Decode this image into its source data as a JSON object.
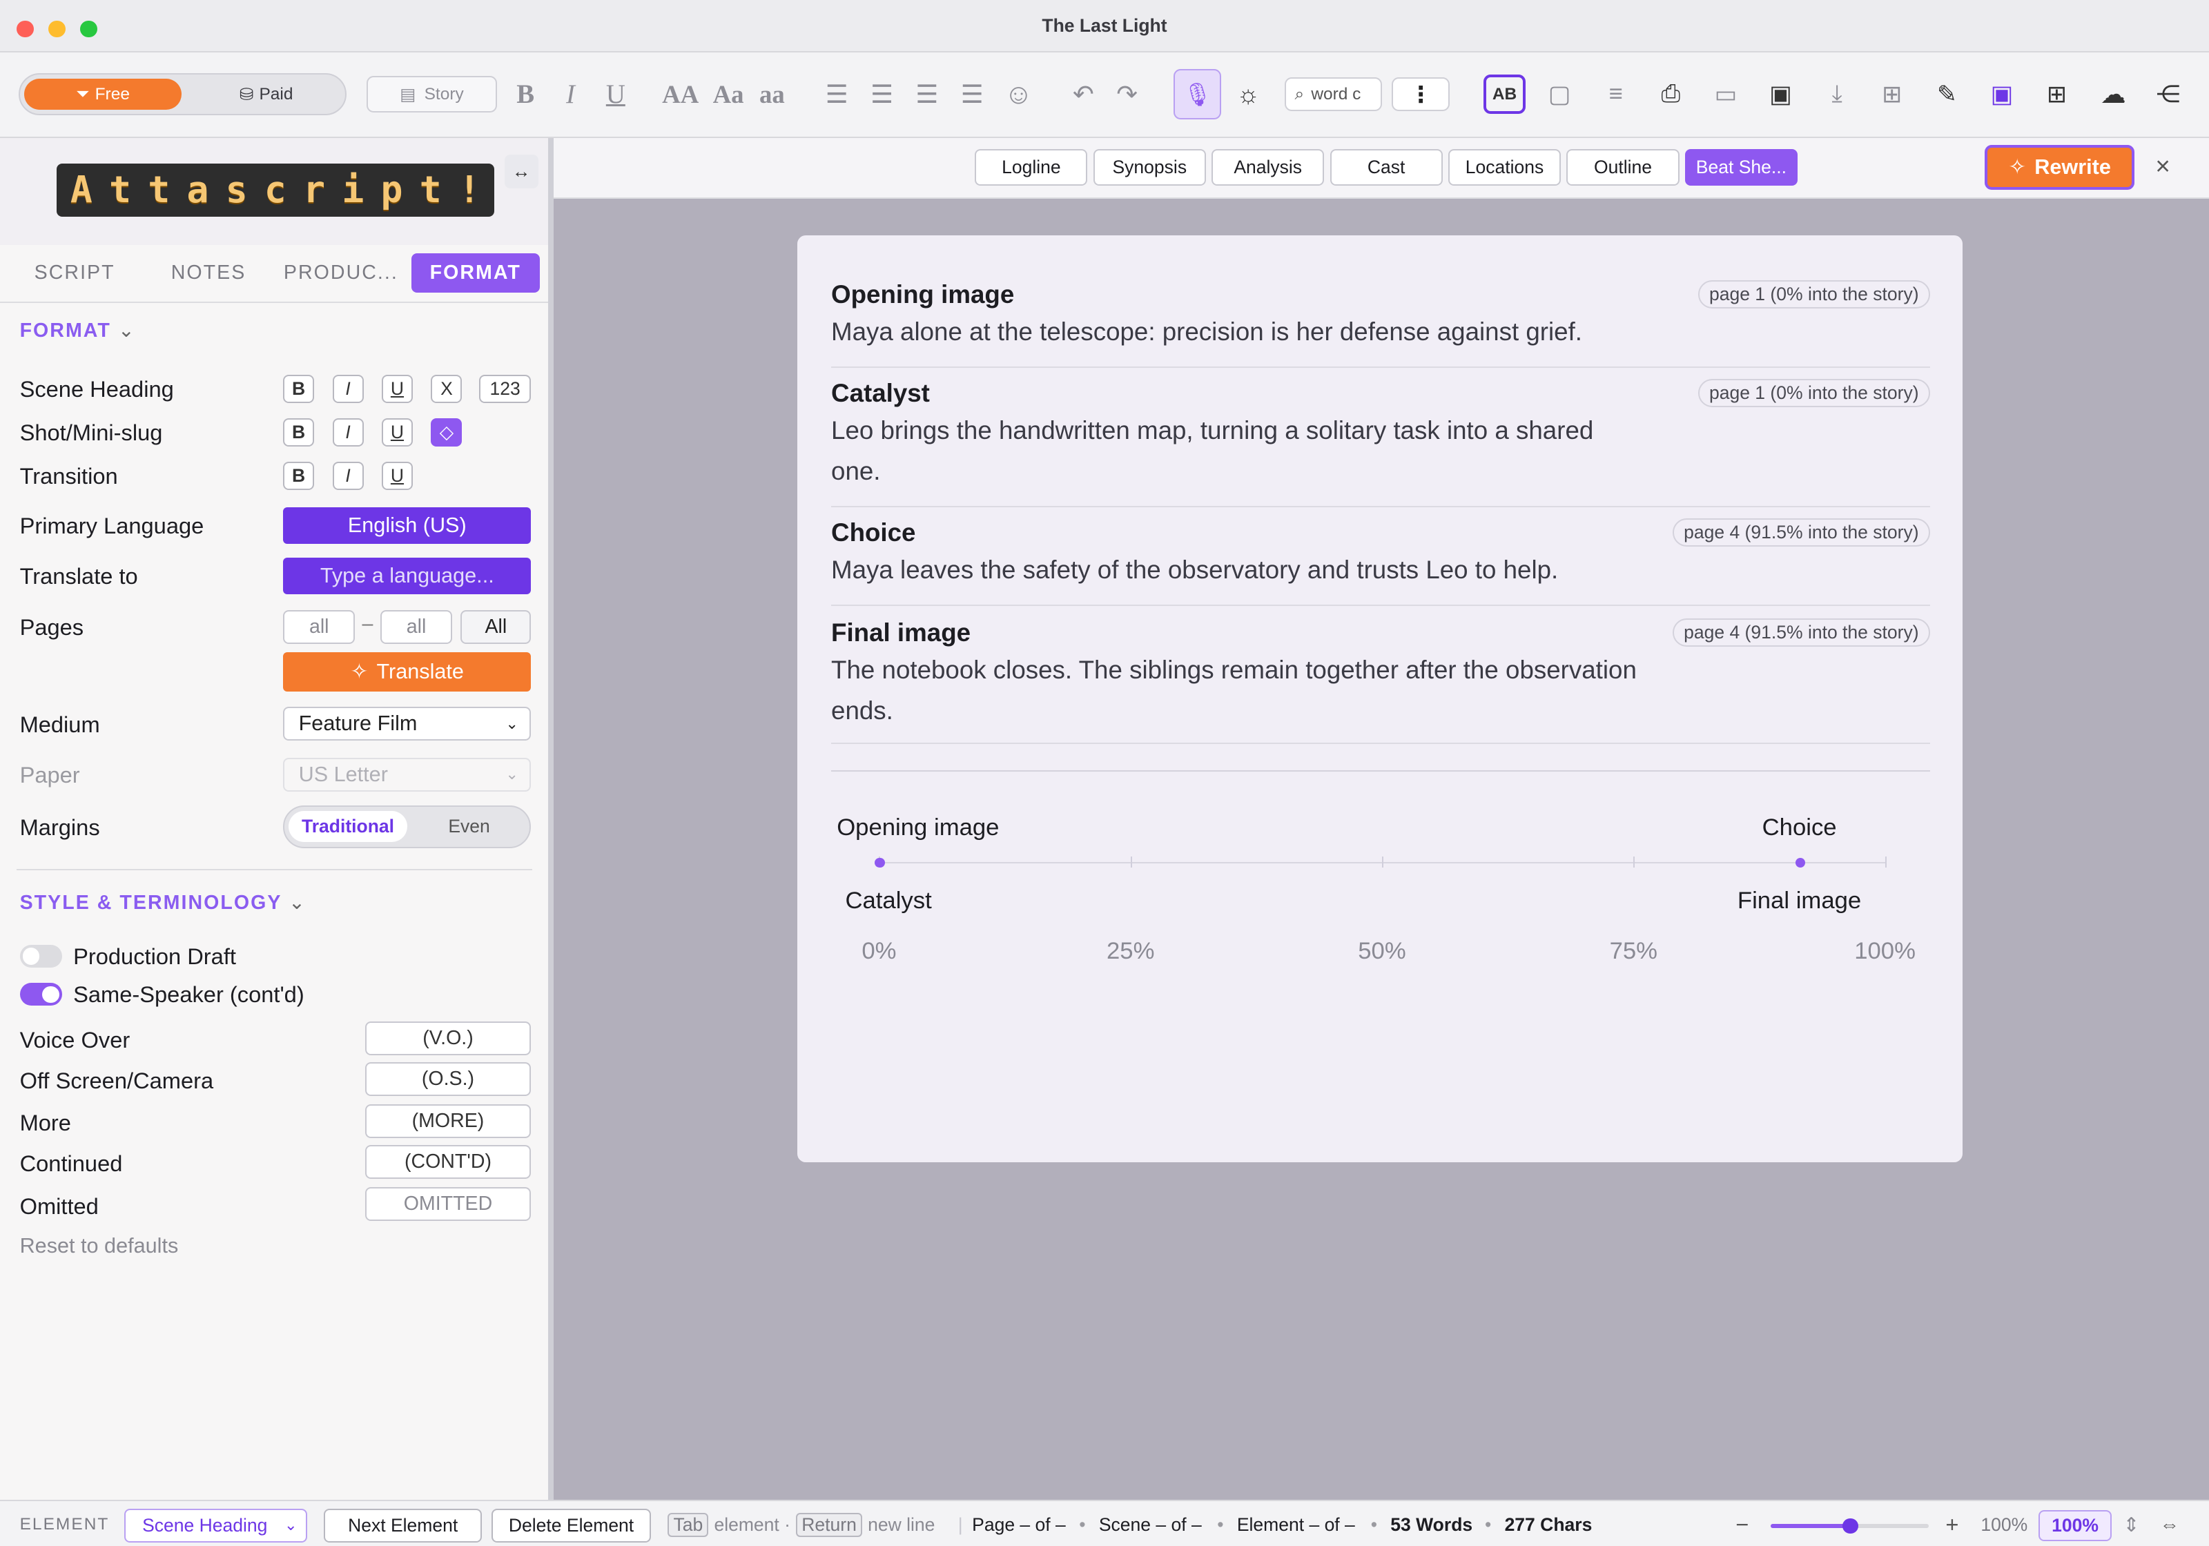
{
  "window": {
    "title": "The Last Light"
  },
  "toolbar": {
    "free_label": "Free",
    "paid_label": "Paid",
    "story_label": "Story",
    "search_placeholder": "word c",
    "accent": "#8e58f0",
    "orange": "#f47a2d"
  },
  "sidebar": {
    "tabs": [
      "SCRIPT",
      "NOTES",
      "PRODUC...",
      "FORMAT"
    ],
    "format_heading": "FORMAT",
    "rows": {
      "scene_heading": "Scene Heading",
      "shot": "Shot/Mini-slug",
      "transition": "Transition",
      "primary_language": "Primary Language",
      "translate_to": "Translate to",
      "pages": "Pages",
      "medium": "Medium",
      "paper": "Paper",
      "margins": "Margins"
    },
    "chip_labels": {
      "b": "B",
      "i": "I",
      "u": "U",
      "x": "X",
      "num": "123"
    },
    "primary_language_value": "English (US)",
    "translate_placeholder": "Type a language...",
    "pages_from": "all",
    "pages_to": "all",
    "pages_all_button": "All",
    "translate_button": "Translate",
    "medium_value": "Feature Film",
    "paper_value": "US Letter",
    "margins_options": [
      "Traditional",
      "Even"
    ],
    "style_heading": "STYLE & TERMINOLOGY",
    "toggles": [
      {
        "label": "Production Draft",
        "on": false
      },
      {
        "label": "Same-Speaker (cont'd)",
        "on": true
      }
    ],
    "terms": [
      {
        "label": "Voice Over",
        "value": "(V.O.)"
      },
      {
        "label": "Off Screen/Camera",
        "value": "(O.S.)"
      },
      {
        "label": "More",
        "value": "(MORE)"
      },
      {
        "label": "Continued",
        "value": "(CONT'D)"
      },
      {
        "label": "Omitted",
        "value": "OMITTED"
      }
    ],
    "reset_label": "Reset to defaults"
  },
  "nav": {
    "buttons": [
      "Logline",
      "Synopsis",
      "Analysis",
      "Cast",
      "Locations",
      "Outline",
      "Beat She..."
    ],
    "rewrite_label": "Rewrite",
    "close_label": "×"
  },
  "beats": [
    {
      "name": "Opening image",
      "page": "page 1 (0% into the story)",
      "desc": "Maya alone at the telescope: precision is her defense against grief."
    },
    {
      "name": "Catalyst",
      "page": "page 1 (0% into the story)",
      "desc": "Leo brings the handwritten map, turning a solitary task into a shared one."
    },
    {
      "name": "Choice",
      "page": "page 4 (91.5% into the story)",
      "desc": "Maya leaves the safety of the observatory and trusts Leo to help."
    },
    {
      "name": "Final image",
      "page": "page 4 (91.5% into the story)",
      "desc": "The notebook closes. The siblings remain together after the observation ends."
    }
  ],
  "timeline": {
    "ticks": [
      "0%",
      "25%",
      "50%",
      "75%",
      "100%"
    ],
    "markers": [
      {
        "label_top": "Opening image",
        "label_bottom": "Catalyst",
        "percent": 0
      },
      {
        "label_top": "Choice",
        "label_bottom": "Final image",
        "percent": 91.5
      }
    ]
  },
  "footer": {
    "element_label": "ELEMENT",
    "element_value": "Scene Heading",
    "next_label": "Next Element",
    "delete_label": "Delete Element",
    "tab_key": "Tab",
    "tab_hint": "element ·",
    "return_key": "Return",
    "return_hint": "new line",
    "page": "Page – of –",
    "scene": "Scene – of –",
    "element": "Element – of –",
    "words": "53 Words",
    "chars": "277 Chars",
    "zoom_text": "100%",
    "zoom_box": "100%",
    "zoom_level": 0.5
  }
}
